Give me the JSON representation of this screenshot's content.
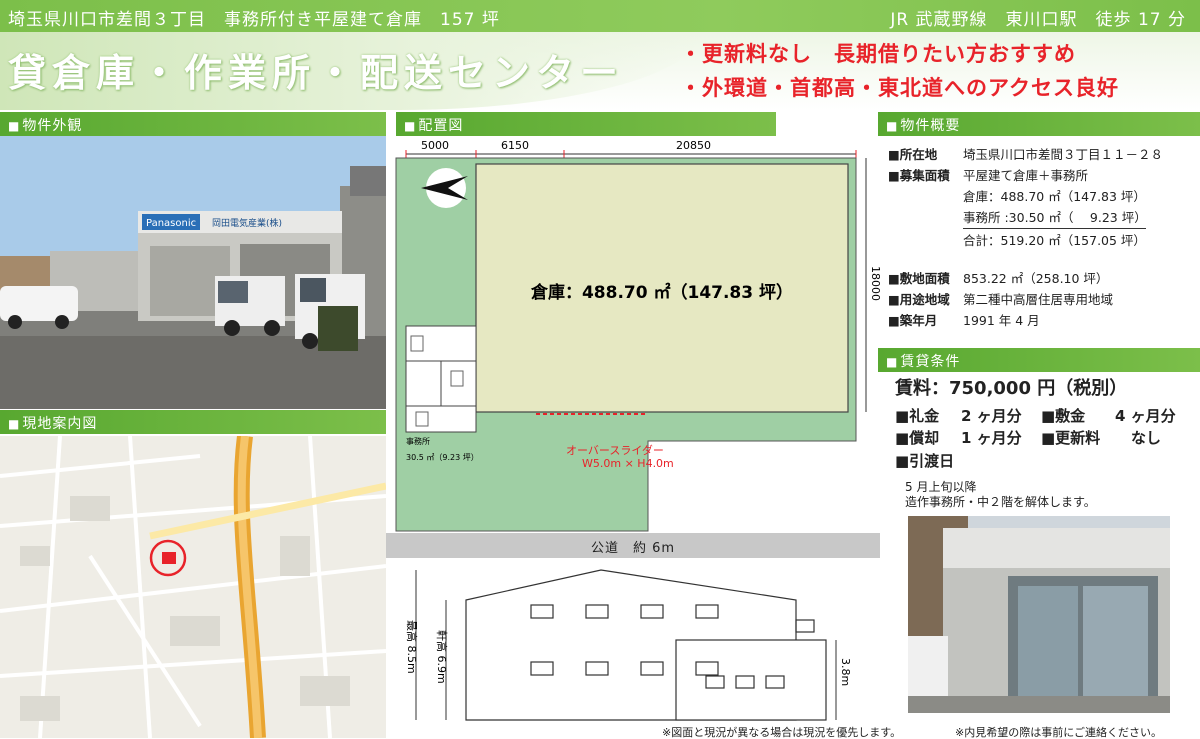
{
  "header": {
    "location_title": "埼玉県川口市差間３丁目　事務所付き平屋建て倉庫　157 坪",
    "access": "JR 武蔵野線　東川口駅　徒歩 17 分"
  },
  "hero": {
    "title": "貸倉庫・作業所・配送センター",
    "point1": "・更新料なし　長期借りたい方おすすめ",
    "point2": "・外環道・首都高・東北道へのアクセス良好"
  },
  "sections": {
    "exterior": "物件外観",
    "site_plan": "配置図",
    "overview": "物件概要",
    "map": "現地案内図",
    "lease": "賃貸条件"
  },
  "photo": {
    "sign1": "Panasonic",
    "sign2": "岡田電気産業(株)"
  },
  "plan": {
    "dim1": "5000",
    "dim2": "6150",
    "dim3": "20850",
    "dim_side": "18000",
    "warehouse_label": "倉庫：488.70 ㎡（147.83 坪）",
    "office_label": "事務所",
    "office_area": "30.5 ㎡（9.23 坪）",
    "door_label1": "オーバースライダー",
    "door_label2": "W5.0m × H4.0m"
  },
  "road": {
    "label": "公道　約 6m"
  },
  "elevation": {
    "eave": "軒高 6.9m",
    "max": "最高 8.5m",
    "low": "3.8m"
  },
  "overview": {
    "address_k": "■所在地",
    "address_v": "埼玉県川口市差間３丁目１１－２８",
    "area_k": "■募集面積",
    "area_v": "平屋建て倉庫＋事務所",
    "area_warehouse": "倉庫：488.70 ㎡（147.83 坪）",
    "area_office": "事務所 :30.50 ㎡（　 9.23 坪）",
    "area_total": "合計：519.20 ㎡（157.05 坪）",
    "land_k": "■敷地面積",
    "land_v": "853.22 ㎡（258.10 坪）",
    "zone_k": "■用途地域",
    "zone_v": "第二種中高層住居専用地域",
    "built_k": "■築年月",
    "built_v": "1991 年 4 月"
  },
  "lease": {
    "rent": "賃料：750,000 円（税別）",
    "reikin_k": "■礼金",
    "reikin_v": "2 ヶ月分",
    "shikikin_k": "■敷金",
    "shikikin_v": "4 ヶ月分",
    "shokyaku_k": "■償却",
    "shokyaku_v": "1 ヶ月分",
    "koshin_k": "■更新料",
    "koshin_v": "なし",
    "handover_k": "■引渡日",
    "handover_note1": "5 月上旬以降",
    "handover_note2": "造作事務所・中２階を解体します。"
  },
  "footer": {
    "note1": "※図面と現況が異なる場合は現況を優先します。",
    "note2": "※内見希望の際は事前にご連絡ください。"
  },
  "colors": {
    "accent_green": "#7cbf4a",
    "point_red": "#e8232a",
    "plan_green": "#9fcfa4",
    "warehouse_fill": "#e6e8c2"
  }
}
